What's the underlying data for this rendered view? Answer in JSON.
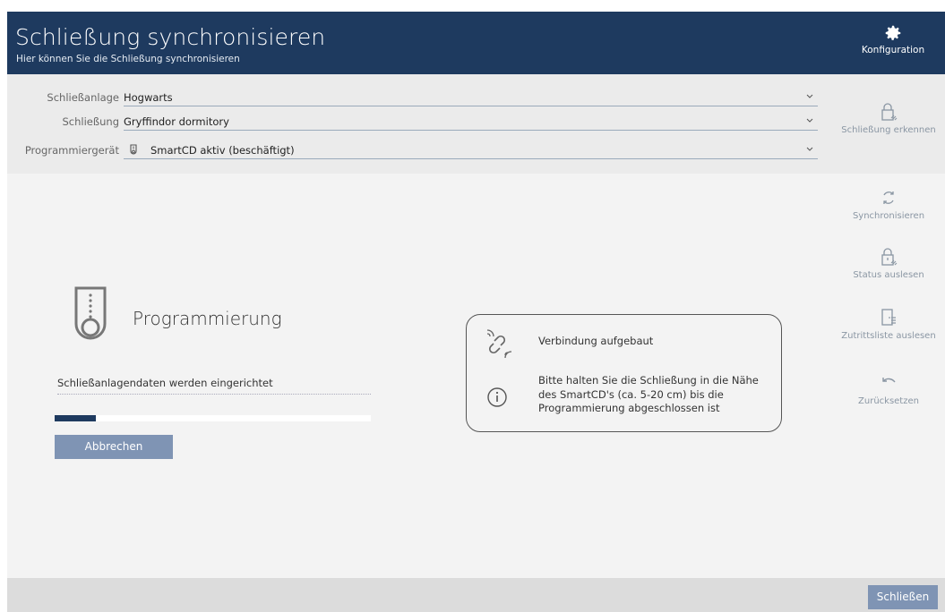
{
  "header": {
    "title": "Schließung synchronisieren",
    "subtitle": "Hier können Sie die Schließung synchronisieren",
    "config_label": "Konfiguration",
    "config_icon": "gear-icon",
    "background": "#1e3a5f"
  },
  "form": {
    "system_label": "Schließanlage",
    "system_value": "Hogwarts",
    "lock_label": "Schließung",
    "lock_value": "Gryffindor dormitory",
    "device_label": "Programmiergerät",
    "device_value": "SmartCD aktiv (beschäftigt)",
    "device_icon": "smartcd-icon"
  },
  "sidebar": {
    "items": [
      {
        "label": "Schließung erkennen",
        "icon": "lock-wave-icon"
      },
      {
        "label": "Synchronisieren",
        "icon": "sync-icon"
      },
      {
        "label": "Status auslesen",
        "icon": "lock-read-icon"
      },
      {
        "label": "Zutrittsliste auslesen",
        "icon": "door-list-icon"
      },
      {
        "label": "Zurücksetzen",
        "icon": "undo-icon"
      }
    ]
  },
  "programming": {
    "title": "Programmierung",
    "status": "Schließanlagendaten werden eingerichtet",
    "progress": 0.13,
    "cancel_label": "Abbrechen"
  },
  "info": {
    "connection_text": "Verbindung aufgebaut",
    "connection_icon": "wireless-link-icon",
    "hint_text": "Bitte halten Sie die Schließung in die Nähe des SmartCD's (ca. 5-20 cm) bis die Programmierung abgeschlossen ist",
    "hint_icon": "info-icon"
  },
  "footer": {
    "close_label": "Schließen"
  }
}
